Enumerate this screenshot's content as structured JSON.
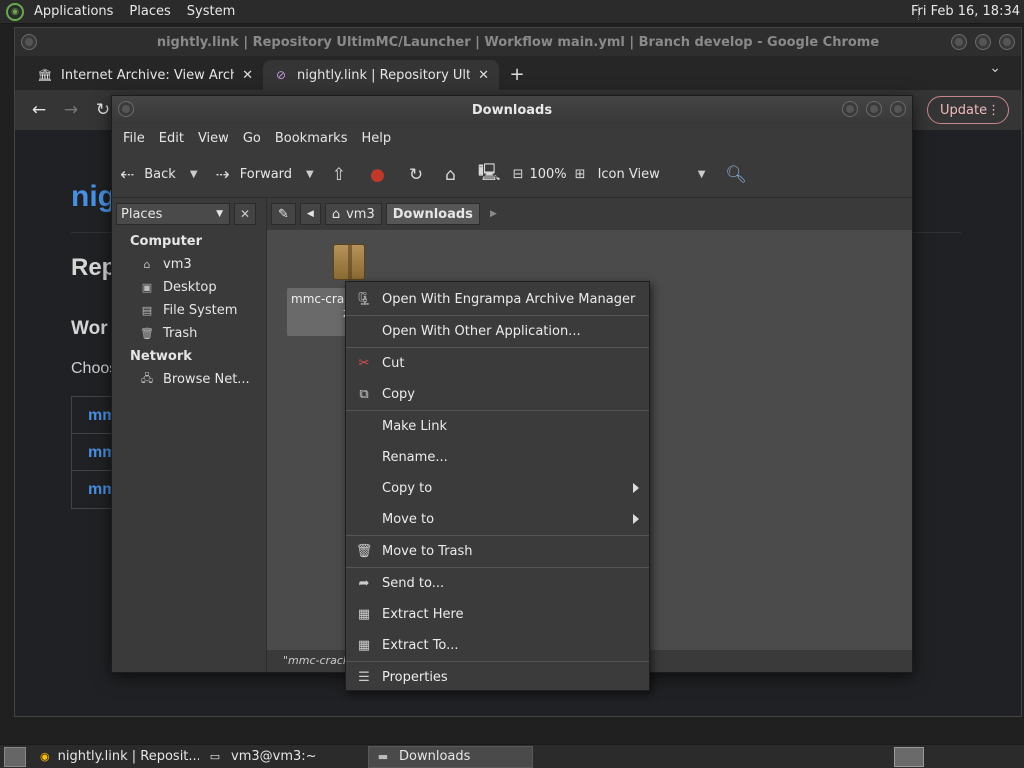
{
  "top_panel": {
    "menus": [
      "Applications",
      "Places",
      "System"
    ],
    "clock": "Fri Feb 16, 18:34"
  },
  "chrome": {
    "title": "nightly.link | Repository UltimMC/Launcher | Workflow main.yml | Branch develop - Google Chrome",
    "tabs": [
      {
        "label": "Internet Archive: View Archive",
        "icon": "archive-icon"
      },
      {
        "label": "nightly.link | Repository Ultim",
        "icon": "nightly-link-icon"
      }
    ],
    "update_label": "Update",
    "page_fragments": {
      "h1": "nig",
      "h2": "Rep",
      "h3": "Wor",
      "p": "Choos",
      "rows": [
        "mm",
        "mm",
        "mm"
      ]
    }
  },
  "file_manager": {
    "title": "Downloads",
    "menubar": [
      "File",
      "Edit",
      "View",
      "Go",
      "Bookmarks",
      "Help"
    ],
    "toolbar": {
      "back": "Back",
      "forward": "Forward",
      "zoom": "100%",
      "view_mode": "Icon View"
    },
    "places_label": "Places",
    "places": {
      "computer_header": "Computer",
      "computer_items": [
        "vm3",
        "Desktop",
        "File System",
        "Trash"
      ],
      "network_header": "Network",
      "network_items": [
        "Browse Net..."
      ]
    },
    "path": [
      "vm3",
      "Downloads"
    ],
    "file_label": "mmc-cra",
    "file_label_line2": "z",
    "status": "\"mmc-cracke"
  },
  "context_menu": {
    "items": [
      {
        "label": "Open With Engrampa Archive Manager",
        "icon": "archive-manager-icon"
      },
      {
        "label": "Open With Other Application..."
      },
      {
        "label": "Cut",
        "icon": "scissors-icon"
      },
      {
        "label": "Copy",
        "icon": "copy-icon"
      },
      {
        "label": "Make Link"
      },
      {
        "label": "Rename..."
      },
      {
        "label": "Copy to"
      },
      {
        "label": "Move to"
      },
      {
        "label": "Move to Trash",
        "icon": "trash-icon"
      },
      {
        "label": "Send to...",
        "icon": "send-icon"
      },
      {
        "label": "Extract Here",
        "icon": "extract-icon"
      },
      {
        "label": "Extract To...",
        "icon": "extract-icon"
      },
      {
        "label": "Properties",
        "icon": "properties-icon"
      }
    ]
  },
  "taskbar": {
    "tasks": [
      {
        "label": "nightly.link | Reposit...",
        "icon": "chrome-icon"
      },
      {
        "label": "vm3@vm3:~",
        "icon": "terminal-icon"
      },
      {
        "label": "Downloads",
        "icon": "folder-icon"
      }
    ]
  },
  "colors": {
    "accent_link": "#4a90e2",
    "update_border": "#c7868a",
    "stop_icon": "#c0392b"
  }
}
